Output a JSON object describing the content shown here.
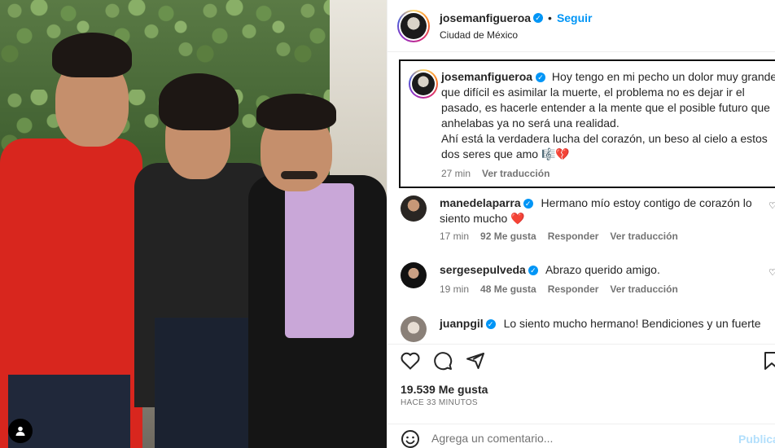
{
  "post": {
    "author": "josemanfigueroa",
    "follow_label": "Seguir",
    "location": "Ciudad de México",
    "caption_line1": "Hoy tengo en mi pecho un dolor muy grande, que difícil es asimilar la muerte, el problema no es dejar ir el pasado, es hacerle entender a la mente que el posible futuro que anhelabas ya no será una realidad.",
    "caption_line2": "Ahí está la verdadera lucha del corazón, un beso al cielo a estos dos seres que amo 🎼💔",
    "caption_time": "27 min",
    "translate_label": "Ver traducción"
  },
  "comments": [
    {
      "user": "manedelaparra",
      "text": "Hermano mío estoy contigo de corazón lo siento mucho ❤️",
      "time": "17 min",
      "likes": "92 Me gusta",
      "reply": "Responder",
      "translate": "Ver traducción"
    },
    {
      "user": "sergesepulveda",
      "text": "Abrazo querido amigo.",
      "time": "19 min",
      "likes": "48 Me gusta",
      "reply": "Responder",
      "translate": "Ver traducción"
    },
    {
      "user": "juanpgil",
      "text": "Lo siento mucho hermano! Bendiciones y un fuerte"
    }
  ],
  "engagement": {
    "likes": "19.539 Me gusta",
    "time_ago": "HACE 33 MINUTOS"
  },
  "composer": {
    "placeholder": "Agrega un comentario...",
    "publish_label": "Publicar"
  },
  "icons": {
    "like": "heart-icon",
    "comment": "comment-icon",
    "share": "share-icon",
    "save": "bookmark-icon",
    "emoji": "emoji-icon",
    "verified": "verified-badge-icon"
  },
  "colors": {
    "accent": "#0095f6",
    "heart_red": "#ed4956",
    "muted": "#737373",
    "publish_disabled": "#b2dffc"
  }
}
